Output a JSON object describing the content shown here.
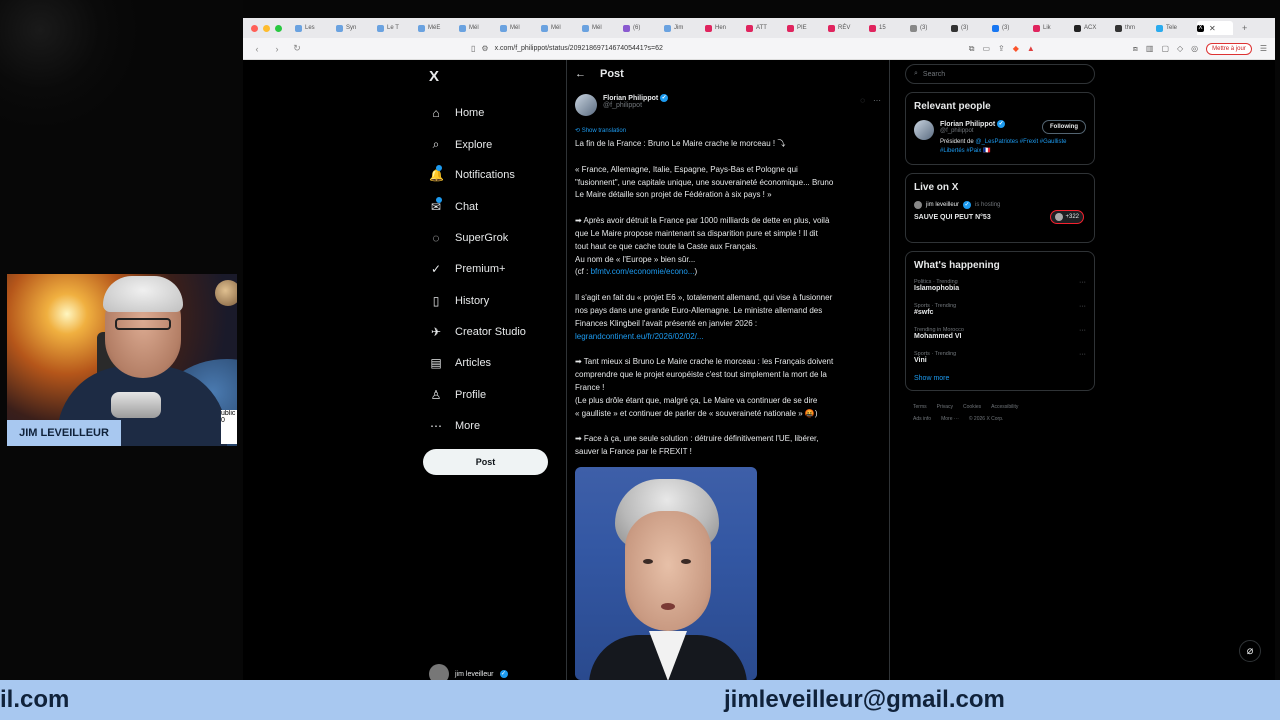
{
  "browser": {
    "tabs": [
      {
        "label": "Les",
        "color": "#6aa2e0"
      },
      {
        "label": "Syn",
        "color": "#6aa2e0"
      },
      {
        "label": "Le T",
        "color": "#6aa2e0"
      },
      {
        "label": "MéE",
        "color": "#6aa2e0"
      },
      {
        "label": "Mél",
        "color": "#6aa2e0"
      },
      {
        "label": "Mél",
        "color": "#6aa2e0"
      },
      {
        "label": "Mél",
        "color": "#6aa2e0"
      },
      {
        "label": "Mél",
        "color": "#6aa2e0"
      },
      {
        "label": "(6)",
        "color": "#8a5ad0"
      },
      {
        "label": "Jim",
        "color": "#6aa2e0"
      },
      {
        "label": "Hen",
        "color": "#e0245e"
      },
      {
        "label": "ATT",
        "color": "#e0245e"
      },
      {
        "label": "PIE",
        "color": "#e0245e"
      },
      {
        "label": "RÉV",
        "color": "#e0245e"
      },
      {
        "label": "15",
        "color": "#e0245e"
      },
      {
        "label": "(3)",
        "color": "#888888"
      },
      {
        "label": "(3)",
        "color": "#333333"
      },
      {
        "label": "(3)",
        "color": "#1877f2"
      },
      {
        "label": "Lik",
        "color": "#e0245e"
      },
      {
        "label": "ACX",
        "color": "#222222"
      },
      {
        "label": "thm",
        "color": "#333333"
      },
      {
        "label": "Tele",
        "color": "#2aabee"
      }
    ],
    "url": "x.com/f_philippot/status/2092186971467405441?s=62",
    "update_button": "Mettre à jour"
  },
  "nav": {
    "logo": "X",
    "items": [
      {
        "label": "Home",
        "icon": "⌂"
      },
      {
        "label": "Explore",
        "icon": "⌕"
      },
      {
        "label": "Notifications",
        "icon": "🔔"
      },
      {
        "label": "Chat",
        "icon": "✉"
      },
      {
        "label": "SuperGrok",
        "icon": "◌"
      },
      {
        "label": "Premium+",
        "icon": "✓"
      },
      {
        "label": "History",
        "icon": "▯"
      },
      {
        "label": "Creator Studio",
        "icon": "✈"
      },
      {
        "label": "Articles",
        "icon": "▤"
      },
      {
        "label": "Profile",
        "icon": "♙"
      },
      {
        "label": "More",
        "icon": "⋯"
      }
    ],
    "post_button": "Post",
    "account_name": "jim leveilleur"
  },
  "post": {
    "header": "Post",
    "author_name": "Florian Philippot",
    "author_handle": "@f_philippot",
    "show_translation": "Show translation",
    "paragraphs": [
      [
        "La fin de la France : Bruno Le Maire crache le morceau ! ⤵"
      ],
      [
        "« France, Allemagne, Italie, Espagne, Pays-Bas et Pologne qui",
        "\"fusionnent\", une capitale unique, une souveraineté économique... Bruno",
        "Le Maire détaille son projet de Fédération à six pays ! »"
      ],
      [
        "➡ Après avoir détruit la France par 1000 milliards de dette en plus, voilà",
        "que Le Maire propose maintenant sa disparition pure et simple ! Il dit",
        "tout haut ce que cache toute la Caste aux Français.",
        "Au nom de « l'Europe » bien sûr...",
        "(cf : bfmtv.com/economie/econo...)"
      ],
      [
        "Il s'agit en fait du « projet E6 », totalement allemand, qui vise à fusionner",
        "nos pays dans une grande Euro-Allemagne. Le ministre allemand des",
        "Finances Klingbeil l'avait présenté en janvier 2026 :",
        "legrandcontinent.eu/fr/2026/02/02/..."
      ],
      [
        "➡ Tant mieux si Bruno Le Maire crache le morceau : les Français doivent",
        "comprendre que le projet européiste c'est tout simplement la mort de la",
        "France !",
        "(Le plus drôle étant que, malgré ça, Le Maire va continuer de se dire",
        "« gaulliste » et continuer de parler de « souveraineté nationale » 🤬)"
      ],
      [
        "➡ Face à ça, une seule solution : détruire définitivement l'UE, libérer,",
        "sauver la France par le FREXIT !"
      ]
    ],
    "link_color": "#1d9bf0"
  },
  "sidebar": {
    "search_placeholder": "Search",
    "relevant": {
      "title": "Relevant people",
      "name": "Florian Philippot",
      "handle": "@f_philippot",
      "follow_label": "Following",
      "bio_prefix": "Président de ",
      "bio_tags": "@_LesPatriotes #Frexit #Gaulliste #Libertés #Paix 🇫🇷"
    },
    "live": {
      "title": "Live on X",
      "host": "jim leveilleur",
      "status": "is hosting",
      "show": "SAUVE QUI PEUT N°53",
      "count": "+322"
    },
    "happening": {
      "title": "What's happening",
      "trends": [
        {
          "meta": "Politics · Trending",
          "topic": "Islamophobia"
        },
        {
          "meta": "Sports · Trending",
          "topic": "#swfc"
        },
        {
          "meta": "Trending in Morocco",
          "topic": "Mohammed VI"
        },
        {
          "meta": "Sports · Trending",
          "topic": "Vini"
        }
      ],
      "show_more": "Show more"
    },
    "footer": [
      "Terms",
      "Privacy",
      "Cookies",
      "Accessibility",
      "Ads info",
      "More ···",
      "© 2026 X Corp."
    ]
  },
  "webcam": {
    "label": "JIM LEVEILLEUR",
    "side_text": "ublic 0"
  },
  "banner": {
    "left_text": "il.com",
    "right_text": "jimleveilleur@gmail.com"
  }
}
